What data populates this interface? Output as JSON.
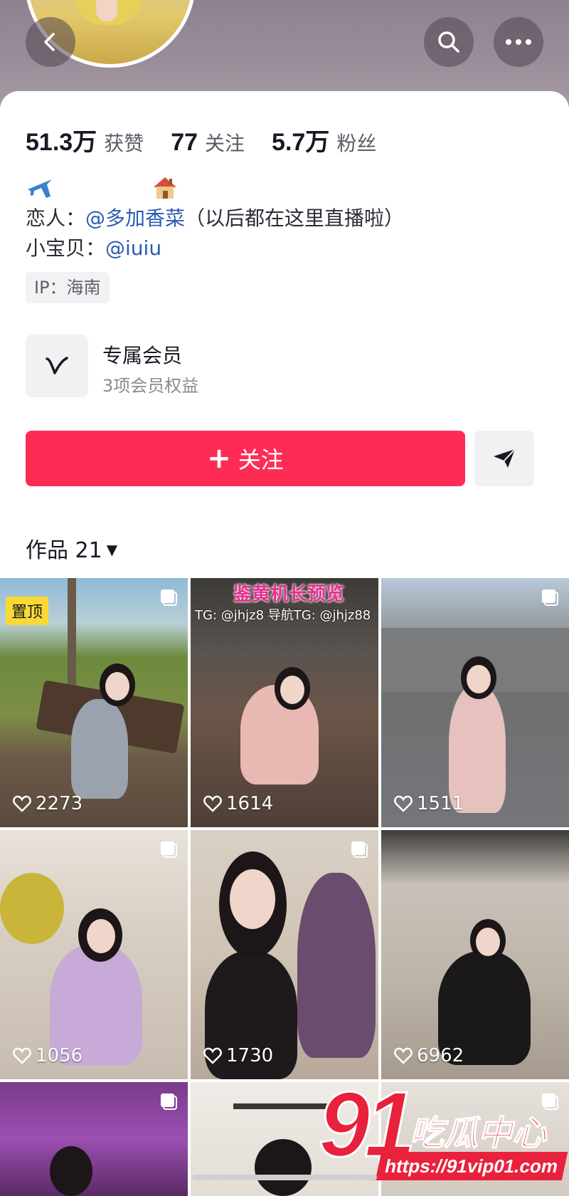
{
  "header": {
    "back_icon": "chevron-left-icon",
    "search_icon": "search-icon",
    "more_icon": "more-horizontal-icon"
  },
  "stats": [
    {
      "value": "51.3万",
      "label": "获赞"
    },
    {
      "value": "77",
      "label": "关注"
    },
    {
      "value": "5.7万",
      "label": "粉丝"
    }
  ],
  "bio": {
    "emoji_1": "airplane-icon",
    "emoji_2": "house-icon",
    "line1_prefix": "恋人：",
    "line1_mention": "@多加香菜",
    "line1_suffix": "（以后都在这里直播啦）",
    "line2_prefix": "小宝贝：",
    "line2_mention": "@iuiu",
    "ip_tag": "IP：海南"
  },
  "member": {
    "title": "专属会员",
    "subtitle": "3项会员权益"
  },
  "actions": {
    "follow_label": "关注",
    "follow_color": "#fe2c55"
  },
  "works": {
    "tab_label": "作品 21"
  },
  "grid": {
    "items": [
      {
        "likes": "2273",
        "pinned": "置顶"
      },
      {
        "likes": "1614",
        "banner_title": "鉴黄机长预览",
        "banner_sub": "TG: @jhjz8 导航TG: @jhjz88"
      },
      {
        "likes": "1511"
      },
      {
        "likes": "1056"
      },
      {
        "likes": "1730"
      },
      {
        "likes": "6962"
      }
    ]
  },
  "watermark": {
    "number": "91",
    "text": "吃瓜中心",
    "url": "https://91vip01.com"
  }
}
